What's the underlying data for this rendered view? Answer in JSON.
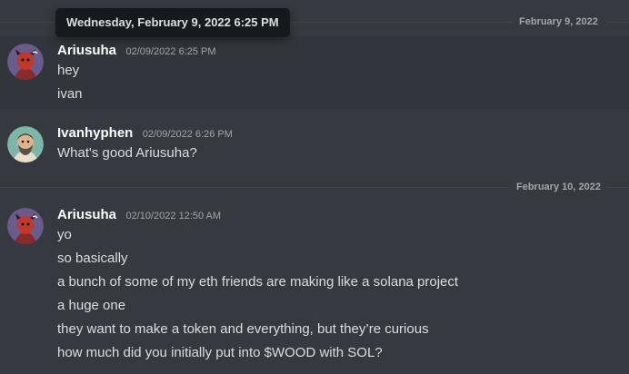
{
  "tooltip": {
    "text": "Wednesday, February 9, 2022 6:25 PM"
  },
  "dividers": [
    {
      "label": "February 9, 2022"
    },
    {
      "label": "February 10, 2022"
    }
  ],
  "messages": [
    {
      "author": "Ariusuha",
      "timestamp": "02/09/2022 6:25 PM",
      "avatar_icon": "red-demon-avatar-icon",
      "lines": [
        "hey",
        "ivan"
      ]
    },
    {
      "author": "Ivanhyphen",
      "timestamp": "02/09/2022 6:26 PM",
      "avatar_icon": "bearded-man-avatar-icon",
      "lines": [
        "What's good Ariusuha?"
      ]
    },
    {
      "author": "Ariusuha",
      "timestamp": "02/10/2022 12:50 AM",
      "avatar_icon": "red-demon-avatar-icon",
      "lines": [
        "yo",
        "so basically",
        "a bunch of some of my eth friends are making like a solana project",
        "a huge one",
        "they want to make a token and everything, but they’re curious",
        "how much did you initially put into $WOOD with SOL?"
      ]
    }
  ],
  "colors": {
    "background": "#36393f",
    "hover_background": "#32353b",
    "username": "#ffffff",
    "text": "#dcddde",
    "muted": "#a3a6aa",
    "tooltip_bg": "#18191c"
  }
}
